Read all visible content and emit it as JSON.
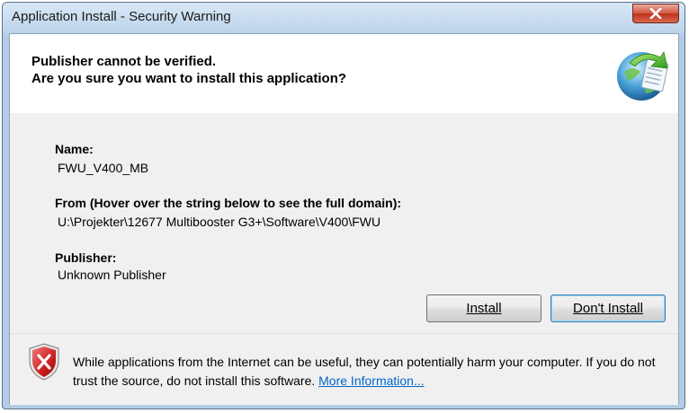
{
  "window": {
    "title": "Application Install - Security Warning"
  },
  "header": {
    "line1": "Publisher cannot be verified.",
    "line2": "Are you sure you want to install this application?"
  },
  "fields": {
    "name_label": "Name:",
    "name_value": "FWU_V400_MB",
    "from_label": "From (Hover over the string below to see the full domain):",
    "from_value": "U:\\Projekter\\12677 Multibooster G3+\\Software\\V400\\FWU",
    "publisher_label": "Publisher:",
    "publisher_value": "Unknown Publisher"
  },
  "buttons": {
    "install_label": "Install",
    "dont_install_label": "Don't Install"
  },
  "footer": {
    "warning_text": "While applications from the Internet can be useful, they can potentially harm your computer. If you do not trust the source, do not install this software.",
    "more_info_label": "More Information..."
  },
  "icons": {
    "app_logo": "clickonce-globe-icon",
    "shield": "shield-warning-icon",
    "close": "close-icon"
  },
  "colors": {
    "link": "#0066cc",
    "close_button": "#c0321a",
    "shield_red": "#cc1f1f"
  }
}
